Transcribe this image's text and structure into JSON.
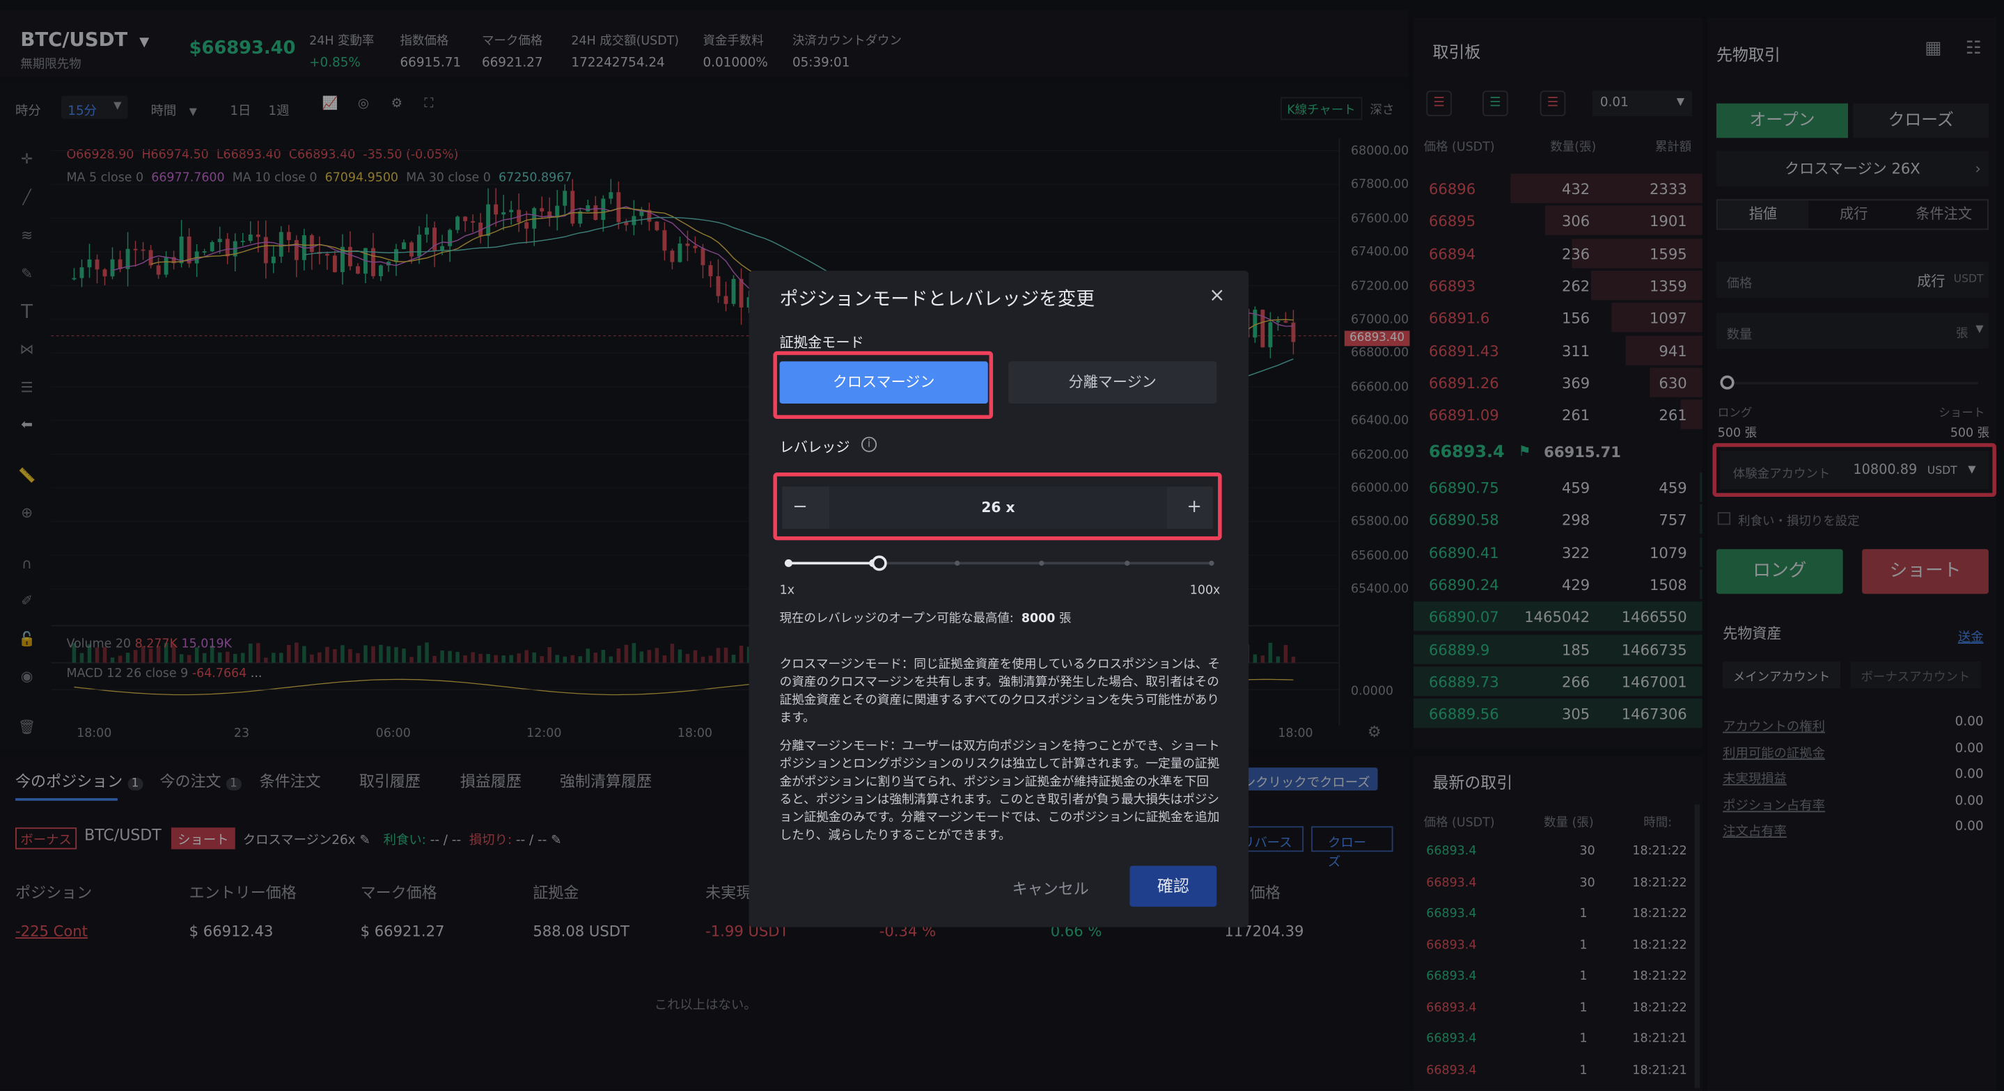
{
  "header": {
    "symbol": "BTC/USDT",
    "contract_type": "無期限先物",
    "last_price": "$66893.40",
    "stats": [
      {
        "label": "24H 変動率",
        "value": "+0.85%"
      },
      {
        "label": "指数価格",
        "value": "66915.71"
      },
      {
        "label": "マーク価格",
        "value": "66921.27"
      },
      {
        "label": "24H 成交額(USDT)",
        "value": "172242754.24"
      },
      {
        "label": "資金手数料",
        "value": "0.01000%"
      },
      {
        "label": "決済カウントダウン",
        "value": "05:39:01"
      }
    ]
  },
  "chart_toolbar": {
    "timeframe": "時分",
    "interval": "15分",
    "period_select": "時間",
    "day": "1日",
    "week": "1週",
    "kline_tab": "K線チャート",
    "depth_tab": "深さ"
  },
  "chart_info": {
    "ohlc": "O66928.90  H66974.50  L66893.40  C66893.40  -35.50 (-0.05%)",
    "ma5": "MA 5 close 0",
    "ma5_val": "66977.7600",
    "ma10": "MA 10 close 0",
    "ma10_val": "67094.9500",
    "ma30": "MA 30 close 0",
    "ma30_val": "67250.8967",
    "volume": "Volume 20",
    "vol_a": "8.277K",
    "vol_b": "15.019K",
    "macd": "MACD 12 26 close 9",
    "macd_val": "-64.7664",
    "macd_more": "..."
  },
  "chart_data": {
    "type": "line",
    "y_ticks": [
      "68000.00",
      "67800.00",
      "67600.00",
      "67400.00",
      "67200.00",
      "67000.00",
      "66800.00",
      "66600.00",
      "66400.00",
      "66200.00",
      "66000.00",
      "65800.00",
      "65600.00",
      "65400.00"
    ],
    "current_price_tag": "66893.40",
    "macd_tick": "0.0000",
    "x_ticks": [
      "18:00",
      "23",
      "06:00",
      "12:00",
      "18:00",
      "18:00"
    ]
  },
  "orderbook": {
    "title": "取引板",
    "precision": "0.01",
    "col_price": "価格 (USDT)",
    "col_qty": "数量(張)",
    "col_cum": "累計額",
    "asks": [
      {
        "price": "66896",
        "qty": "432",
        "cum": "2333",
        "depth": 1.0
      },
      {
        "price": "66895",
        "qty": "306",
        "cum": "1901",
        "depth": 0.82
      },
      {
        "price": "66894",
        "qty": "236",
        "cum": "1595",
        "depth": 0.68
      },
      {
        "price": "66893",
        "qty": "262",
        "cum": "1359",
        "depth": 0.58
      },
      {
        "price": "66891.6",
        "qty": "156",
        "cum": "1097",
        "depth": 0.47
      },
      {
        "price": "66891.43",
        "qty": "311",
        "cum": "941",
        "depth": 0.4
      },
      {
        "price": "66891.26",
        "qty": "369",
        "cum": "630",
        "depth": 0.27
      },
      {
        "price": "66891.09",
        "qty": "261",
        "cum": "261",
        "depth": 0.11
      }
    ],
    "mid_price": "66893.4",
    "mid_index": "66915.71",
    "bids": [
      {
        "price": "66890.75",
        "qty": "459",
        "cum": "459",
        "depth": 0.0003
      },
      {
        "price": "66890.58",
        "qty": "298",
        "cum": "757",
        "depth": 0.0005
      },
      {
        "price": "66890.41",
        "qty": "322",
        "cum": "1079",
        "depth": 0.0007
      },
      {
        "price": "66890.24",
        "qty": "429",
        "cum": "1508",
        "depth": 0.001
      },
      {
        "price": "66890.07",
        "qty": "1465042",
        "cum": "1466550",
        "depth": 1.0
      },
      {
        "price": "66889.9",
        "qty": "185",
        "cum": "1466735",
        "depth": 1.0
      },
      {
        "price": "66889.73",
        "qty": "266",
        "cum": "1467001",
        "depth": 1.0
      },
      {
        "price": "66889.56",
        "qty": "305",
        "cum": "1467306",
        "depth": 1.0
      }
    ]
  },
  "trades": {
    "title": "最新の取引",
    "col_price": "価格 (USDT)",
    "col_qty": "数量 (張)",
    "col_time": "時間:",
    "rows": [
      {
        "price": "66893.4",
        "qty": "30",
        "time": "18:21:22",
        "side": "buy"
      },
      {
        "price": "66893.4",
        "qty": "30",
        "time": "18:21:22",
        "side": "sell"
      },
      {
        "price": "66893.4",
        "qty": "1",
        "time": "18:21:22",
        "side": "buy"
      },
      {
        "price": "66893.4",
        "qty": "1",
        "time": "18:21:22",
        "side": "sell"
      },
      {
        "price": "66893.4",
        "qty": "1",
        "time": "18:21:22",
        "side": "buy"
      },
      {
        "price": "66893.4",
        "qty": "1",
        "time": "18:21:22",
        "side": "sell"
      },
      {
        "price": "66893.4",
        "qty": "1",
        "time": "18:21:21",
        "side": "buy"
      },
      {
        "price": "66893.4",
        "qty": "1",
        "time": "18:21:21",
        "side": "sell"
      }
    ]
  },
  "trade_panel": {
    "title": "先物取引",
    "open_tab": "オープン",
    "close_tab": "クローズ",
    "margin_mode": "クロスマージン 26X",
    "order_types": [
      "指値",
      "成行",
      "条件注文"
    ],
    "price_label": "価格",
    "price_value": "成行",
    "price_unit": "USDT",
    "qty_label": "数量",
    "qty_unit": "張",
    "long_label": "ロング",
    "long_max": "500 張",
    "short_label": "ショート",
    "short_max": "500 張",
    "account_label": "体験金アカウント",
    "account_value": "10800.89",
    "account_unit": "USDT",
    "tpsl_label": "利食い・損切りを設定",
    "long_button": "ロング",
    "short_button": "ショート"
  },
  "assets": {
    "title": "先物資産",
    "transfer": "送金",
    "main_account": "メインアカウント",
    "bonus_account": "ボーナスアカウント",
    "rows": [
      {
        "label": "アカウントの権利",
        "value": "0.00"
      },
      {
        "label": "利用可能の証拠金",
        "value": "0.00"
      },
      {
        "label": "未実現損益",
        "value": "0.00"
      },
      {
        "label": "ポジション占有率",
        "value": "0.00"
      },
      {
        "label": "注文占有率",
        "value": "0.00"
      }
    ]
  },
  "positions": {
    "tabs": [
      {
        "label": "今のポジション",
        "count": "1"
      },
      {
        "label": "今の注文",
        "count": "1"
      },
      {
        "label": "条件注文"
      },
      {
        "label": "取引履歴"
      },
      {
        "label": "損益履歴"
      },
      {
        "label": "強制清算履歴"
      }
    ],
    "one_click_close": "ワンクリックでクローズ",
    "bonus_tag": "ボーナス",
    "symbol": "BTC/USDT",
    "side_tag": "ショート",
    "margin_tag": "クロスマージン26x",
    "tp_label": "利食い:",
    "tp_value": "-- / --",
    "sl_label": "損切り:",
    "sl_value": "-- / --",
    "reverse_btn": "リバース",
    "close_btn": "クローズ",
    "headers": [
      "ポジション",
      "エントリー価格",
      "マーク価格",
      "証拠金",
      "未実現",
      "",
      "",
      "価格"
    ],
    "row": {
      "position": "-225 Cont",
      "entry": "$ 66912.43",
      "mark": "$ 66921.27",
      "margin": "588.08 USDT",
      "pnl": "-1.99 USDT",
      "pnl_pct": "-0.34 %",
      "roe": "0.66 %",
      "liq": "117204.39"
    },
    "no_more": "これ以上はない。"
  },
  "modal": {
    "title": "ポジションモードとレバレッジを変更",
    "margin_mode_label": "証拠金モード",
    "cross_margin": "クロスマージン",
    "isolated_margin": "分離マージン",
    "leverage_label": "レバレッジ",
    "leverage_value": "26 x",
    "leverage_fraction": 0.2525,
    "slider_min": "1x",
    "slider_max": "100x",
    "max_open_text": "現在のレバレッジのオープン可能な最高値:",
    "max_open_value": "8000",
    "max_open_unit": "張",
    "cross_desc": "クロスマージンモード：同じ証拠金資産を使用しているクロスポジションは、その資産のクロスマージンを共有します。強制清算が発生した場合、取引者はその証拠金資産とその資産に関連するすべてのクロスポジションを失う可能性があります。",
    "isolated_desc": "分離マージンモード：ユーザーは双方向ポジションを持つことができ、ショートポジションとロングポジションのリスクは独立して計算されます。一定量の証拠金がポジションに割り当てられ、ポジション証拠金が維持証拠金の水準を下回ると、ポジションは強制清算されます。このとき取引者が負う最大損失はポジション証拠金のみです。分離マージンモードでは、このポジションに証拠金を追加したり、減らしたりすることができます。",
    "cancel": "キャンセル",
    "confirm": "確認"
  },
  "colors": {
    "up": "#2ebd85",
    "down": "#e0525c",
    "accent": "#4a8af4",
    "highlight": "#f0405a"
  }
}
